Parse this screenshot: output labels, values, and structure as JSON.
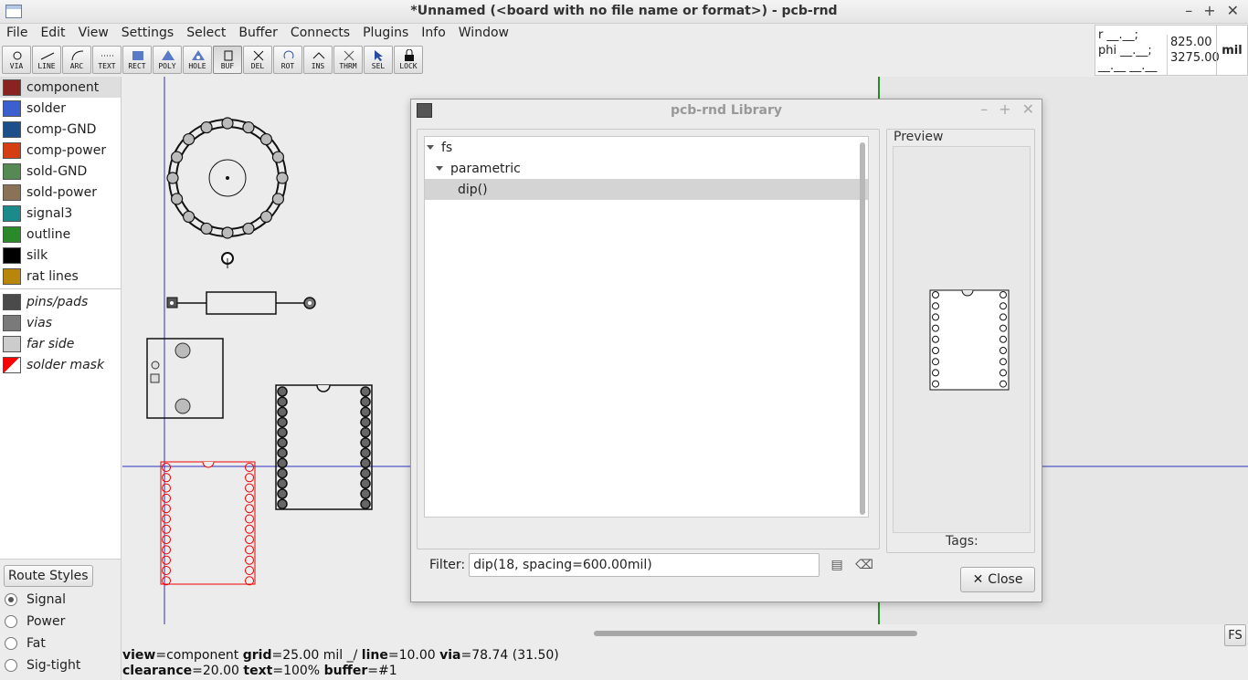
{
  "window": {
    "title": "*Unnamed (<board with no file name or format>) - pcb-rnd",
    "min": "–",
    "max": "+",
    "close": "✕"
  },
  "menu": [
    "File",
    "Edit",
    "View",
    "Settings",
    "Select",
    "Buffer",
    "Connects",
    "Plugins",
    "Info",
    "Window"
  ],
  "tools": [
    {
      "label": "VIA",
      "icon": "via-icon"
    },
    {
      "label": "LINE",
      "icon": "line-icon"
    },
    {
      "label": "ARC",
      "icon": "arc-icon"
    },
    {
      "label": "TEXT",
      "icon": "text-icon"
    },
    {
      "label": "RECT",
      "icon": "rect-icon"
    },
    {
      "label": "POLY",
      "icon": "poly-icon"
    },
    {
      "label": "HOLE",
      "icon": "hole-icon"
    },
    {
      "label": "BUF",
      "icon": "buffer-icon"
    },
    {
      "label": "DEL",
      "icon": "delete-icon"
    },
    {
      "label": "ROT",
      "icon": "rotate-icon"
    },
    {
      "label": "INS",
      "icon": "insert-icon"
    },
    {
      "label": "THRM",
      "icon": "thermal-icon"
    },
    {
      "label": "SEL",
      "icon": "select-icon"
    },
    {
      "label": "LOCK",
      "icon": "lock-icon"
    }
  ],
  "active_tool": "BUF",
  "readout": {
    "r_line": "r __.__;",
    "phi_line": "phi __.__;",
    "blank_line": "__.__ __.__",
    "x": "825.00",
    "y": "3275.00",
    "unit": "mil"
  },
  "layers": [
    {
      "name": "component",
      "color": "#8b2222",
      "selected": true
    },
    {
      "name": "solder",
      "color": "#3b5fcf"
    },
    {
      "name": "comp-GND",
      "color": "#1d4f8a"
    },
    {
      "name": "comp-power",
      "color": "#d43e12"
    },
    {
      "name": "sold-GND",
      "color": "#558a55"
    },
    {
      "name": "sold-power",
      "color": "#8a7256"
    },
    {
      "name": "signal3",
      "color": "#1a8a8a"
    },
    {
      "name": "outline",
      "color": "#2a8a2a"
    },
    {
      "name": "silk",
      "color": "#000000"
    },
    {
      "name": "rat lines",
      "color": "#b8860b"
    }
  ],
  "virtual_layers": [
    {
      "name": "pins/pads",
      "color": "#4a4a4a"
    },
    {
      "name": "vias",
      "color": "#7a7a7a"
    },
    {
      "name": "far side",
      "color": "#cccccc"
    },
    {
      "name": "solder mask",
      "color": "#ff0000"
    }
  ],
  "route_styles": {
    "button": "Route Styles",
    "options": [
      {
        "label": "Signal",
        "checked": true
      },
      {
        "label": "Power",
        "checked": false
      },
      {
        "label": "Fat",
        "checked": false
      },
      {
        "label": "Sig-tight",
        "checked": false
      }
    ]
  },
  "fs_button": "FS",
  "status": {
    "line1": [
      {
        "k": "view",
        "v": "=component"
      },
      {
        "k": "grid",
        "v": "=25.00 mil _/"
      },
      {
        "k": "line",
        "v": "=10.00"
      },
      {
        "k": "via",
        "v": "=78.74 (31.50)"
      }
    ],
    "line2": [
      {
        "k": "clearance",
        "v": "=20.00"
      },
      {
        "k": "text",
        "v": "=100%"
      },
      {
        "k": "buffer",
        "v": "=#1"
      }
    ]
  },
  "library": {
    "title": "pcb-rnd Library",
    "tree": [
      {
        "label": "fs",
        "level": 0,
        "expanded": true
      },
      {
        "label": "parametric",
        "level": 1,
        "expanded": true
      },
      {
        "label": "dip()",
        "level": 2,
        "selected": true
      }
    ],
    "filter_label": "Filter:",
    "filter_value": "dip(18, spacing=600.00mil)",
    "preview_label": "Preview",
    "tags_label": "Tags:",
    "close_label": "Close",
    "close_icon": "✕"
  }
}
